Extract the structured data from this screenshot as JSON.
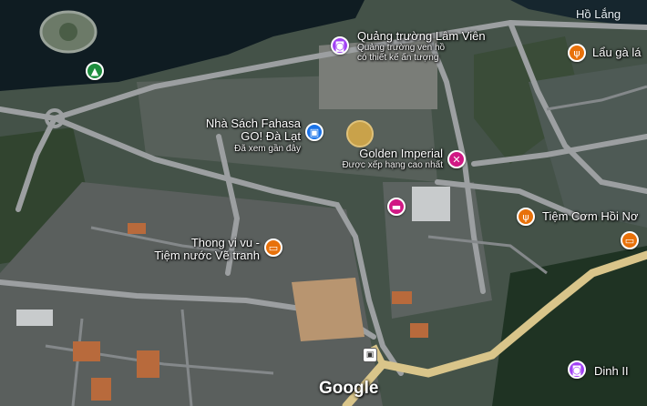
{
  "colors": {
    "pin_green": "#1e8e3e",
    "pin_purple": "#a142f4",
    "pin_blue": "#1a73e8",
    "pin_pink": "#d01884",
    "pin_orange": "#e8710a",
    "highway": "#d9c58a"
  },
  "places": {
    "lake": {
      "label": "Hồ Lắng"
    },
    "quang_truong": {
      "title": "Quảng trường Lâm Viên",
      "sub1": "Quảng trường ven hồ",
      "sub2": "có thiết kế ấn tượng",
      "icon": "camera-icon"
    },
    "lau_ga": {
      "title": "Lẩu gà lá",
      "icon": "fork-knife-icon"
    },
    "fahasa": {
      "title1": "Nhà Sách Fahasa",
      "title2": "GO! Đà Lạt",
      "sub": "Đã xem gần đây",
      "icon": "shopping-bag-icon"
    },
    "golden": {
      "title": "Golden Imperial",
      "sub": "Được xếp hạng cao nhất",
      "icon": "tools-icon"
    },
    "tiem_com": {
      "title": "Tiệm Cơm Hồi Nơ",
      "icon": "fork-knife-icon"
    },
    "thong_vi_vu": {
      "title1": "Thong vi vu -",
      "title2": "Tiệm nước Vẽ tranh",
      "icon": "coffee-icon"
    },
    "dinh_ii": {
      "title": "Dinh II",
      "icon": "camera-icon"
    },
    "park": {
      "icon": "tree-icon"
    },
    "hotel": {
      "icon": "bed-icon"
    },
    "cafe_right": {
      "icon": "coffee-icon"
    }
  },
  "attribution": {
    "brand": "Google"
  }
}
